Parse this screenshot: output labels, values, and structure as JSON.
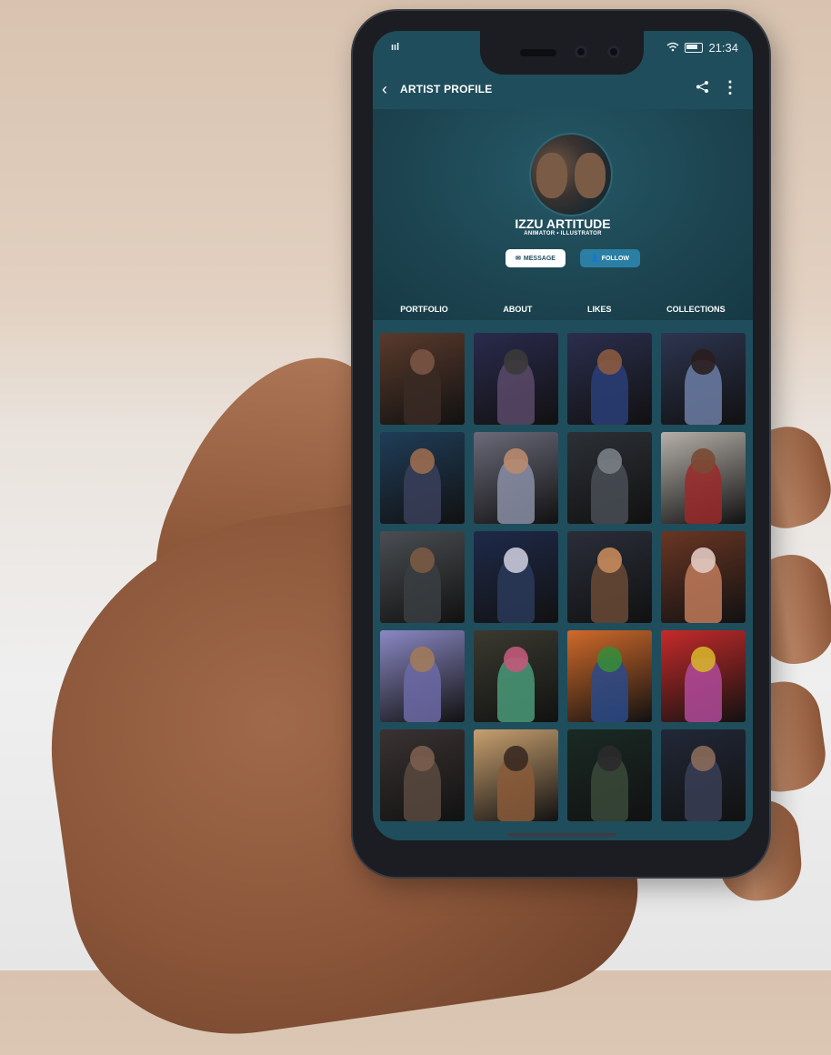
{
  "status_bar": {
    "signal": "ııl",
    "wifi_icon": "wifi-icon",
    "time": "21:34"
  },
  "app_bar": {
    "back_icon": "back-chevron-icon",
    "title": "ARTIST PROFILE",
    "share_icon": "share-icon",
    "more_icon": "more-vert-icon"
  },
  "profile": {
    "name": "IZZU ARTITUDE",
    "role": "ANIMATOR • ILLUSTRATOR",
    "message_label": "MESSAGE",
    "follow_label": "FOLLOW"
  },
  "tabs": [
    {
      "label": "PORTFOLIO"
    },
    {
      "label": "ABOUT"
    },
    {
      "label": "LIKES"
    },
    {
      "label": "COLLECTIONS"
    }
  ],
  "portfolio": [
    {
      "bg": "#5a3a2c",
      "fig": "#3a2a24",
      "head": "#7a5444"
    },
    {
      "bg": "#2a2a4e",
      "fig": "#5a4a6a",
      "head": "#3a3a3a"
    },
    {
      "bg": "#2b2e4e",
      "fig": "#2a3e78",
      "head": "#8a5a40"
    },
    {
      "bg": "#2d3550",
      "fig": "#6c7ea6",
      "head": "#2a1e1e"
    },
    {
      "bg": "#1f3d58",
      "fig": "#3a3f5a",
      "head": "#9a6a4e"
    },
    {
      "bg": "#6a6a7a",
      "fig": "#8a8ea4",
      "head": "#b88a6e"
    },
    {
      "bg": "#2c3036",
      "fig": "#4a4e56",
      "head": "#7a7e86"
    },
    {
      "bg": "#b5b0a8",
      "fig": "#9a2a2a",
      "head": "#7a4a34"
    },
    {
      "bg": "#4a4e52",
      "fig": "#3a3e42",
      "head": "#7a5a44"
    },
    {
      "bg": "#1e2a4a",
      "fig": "#2a3a5a",
      "head": "#c8c8d8"
    },
    {
      "bg": "#2a2e3a",
      "fig": "#6a4a36",
      "head": "#c48a5a"
    },
    {
      "bg": "#6a3624",
      "fig": "#c07a5a",
      "head": "#e0c8c0"
    },
    {
      "bg": "#8a88c4",
      "fig": "#6c6aa6",
      "head": "#a07a5a"
    },
    {
      "bg": "#3a3a30",
      "fig": "#4a9a7a",
      "head": "#c05a7a"
    },
    {
      "bg": "#d06a2a",
      "fig": "#2a4a8a",
      "head": "#3a8a3a"
    },
    {
      "bg": "#c62a2a",
      "fig": "#b04a9a",
      "head": "#d4b02a"
    },
    {
      "bg": "#3a3232",
      "fig": "#5a4a40",
      "head": "#7a5e4e"
    },
    {
      "bg": "#c8a070",
      "fig": "#8a5a3a",
      "head": "#3a2a22"
    },
    {
      "bg": "#1a2a24",
      "fig": "#3a4a3a",
      "head": "#2a2a2a"
    },
    {
      "bg": "#222838",
      "fig": "#3a3e56",
      "head": "#8a6a5a"
    }
  ],
  "colors": {
    "screen_bg": "#1f4d5c",
    "accent": "#2c7fa4"
  }
}
